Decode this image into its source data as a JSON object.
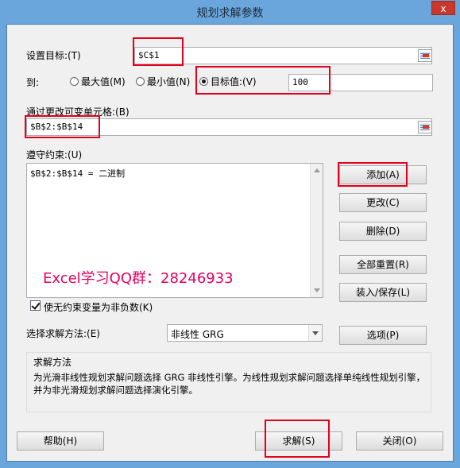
{
  "dialog": {
    "title": "规划求解参数",
    "close_label": "x"
  },
  "objective": {
    "label": "设置目标:(T)",
    "value": "$C$1"
  },
  "to": {
    "label": "到:",
    "options": [
      {
        "label": "最大值(M)",
        "selected": false
      },
      {
        "label": "最小值(N)",
        "selected": false
      },
      {
        "label": "目标值:(V)",
        "selected": true
      }
    ],
    "target_value": "100"
  },
  "changing_cells": {
    "label": "通过更改可变单元格:(B)",
    "value": "$B$2:$B$14"
  },
  "constraints": {
    "label": "遵守约束:(U)",
    "items": [
      "$B$2:$B$14 = 二进制"
    ]
  },
  "buttons": {
    "add": "添加(A)",
    "change": "更改(C)",
    "delete": "删除(D)",
    "reset_all": "全部重置(R)",
    "load_save": "装入/保存(L)",
    "options": "选项(P)",
    "help": "帮助(H)",
    "solve": "求解(S)",
    "close": "关闭(O)"
  },
  "watermark": "Excel学习QQ群：28246933",
  "nonnegative": {
    "label": "使无约束变量为非负数(K)",
    "checked": true
  },
  "method": {
    "label": "选择求解方法:(E)",
    "selected": "非线性 GRG"
  },
  "solving_method": {
    "title": "求解方法",
    "description": "为光滑非线性规划求解问题选择 GRG 非线性引擎。为线性规划求解问题选择单纯线性规划引擎，并为非光滑规划求解问题选择演化引擎。"
  },
  "colors": {
    "frame": "#6aa6dc",
    "highlight": "#e3001b",
    "watermark": "#e6005c",
    "close": "#c8382d"
  },
  "icons": [
    "close-icon",
    "collapse-dialog-icon",
    "checkmark-icon",
    "chevron-down-icon"
  ]
}
